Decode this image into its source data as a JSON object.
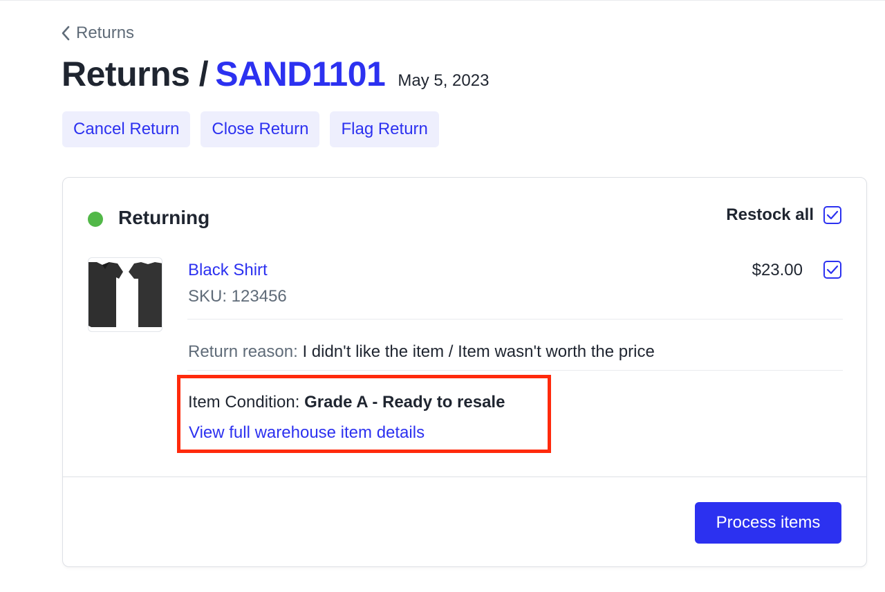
{
  "header": {
    "back_label": "Returns",
    "title_prefix": "Returns /",
    "return_id": "SAND1101",
    "date": "May 5, 2023"
  },
  "actions": {
    "cancel_label": "Cancel Return",
    "close_label": "Close Return",
    "flag_label": "Flag Return"
  },
  "card": {
    "status_label": "Returning",
    "status_color": "#52b848",
    "restock_all_label": "Restock all",
    "restock_all_checked": true,
    "item": {
      "name": "Black Shirt",
      "sku": "SKU: 123456",
      "price": "$23.00",
      "checked": true,
      "image_icon": "black-tshirt-front-back",
      "reason_label": "Return reason:",
      "reason_value": "I didn't like the item / Item wasn't worth the price",
      "condition_label": "Item Condition:",
      "condition_value": "Grade A - Ready to resale",
      "warehouse_link": "View full warehouse item details"
    },
    "process_button_label": "Process items"
  },
  "colors": {
    "accent": "#2c31f0",
    "highlight": "#ff2a0c"
  }
}
